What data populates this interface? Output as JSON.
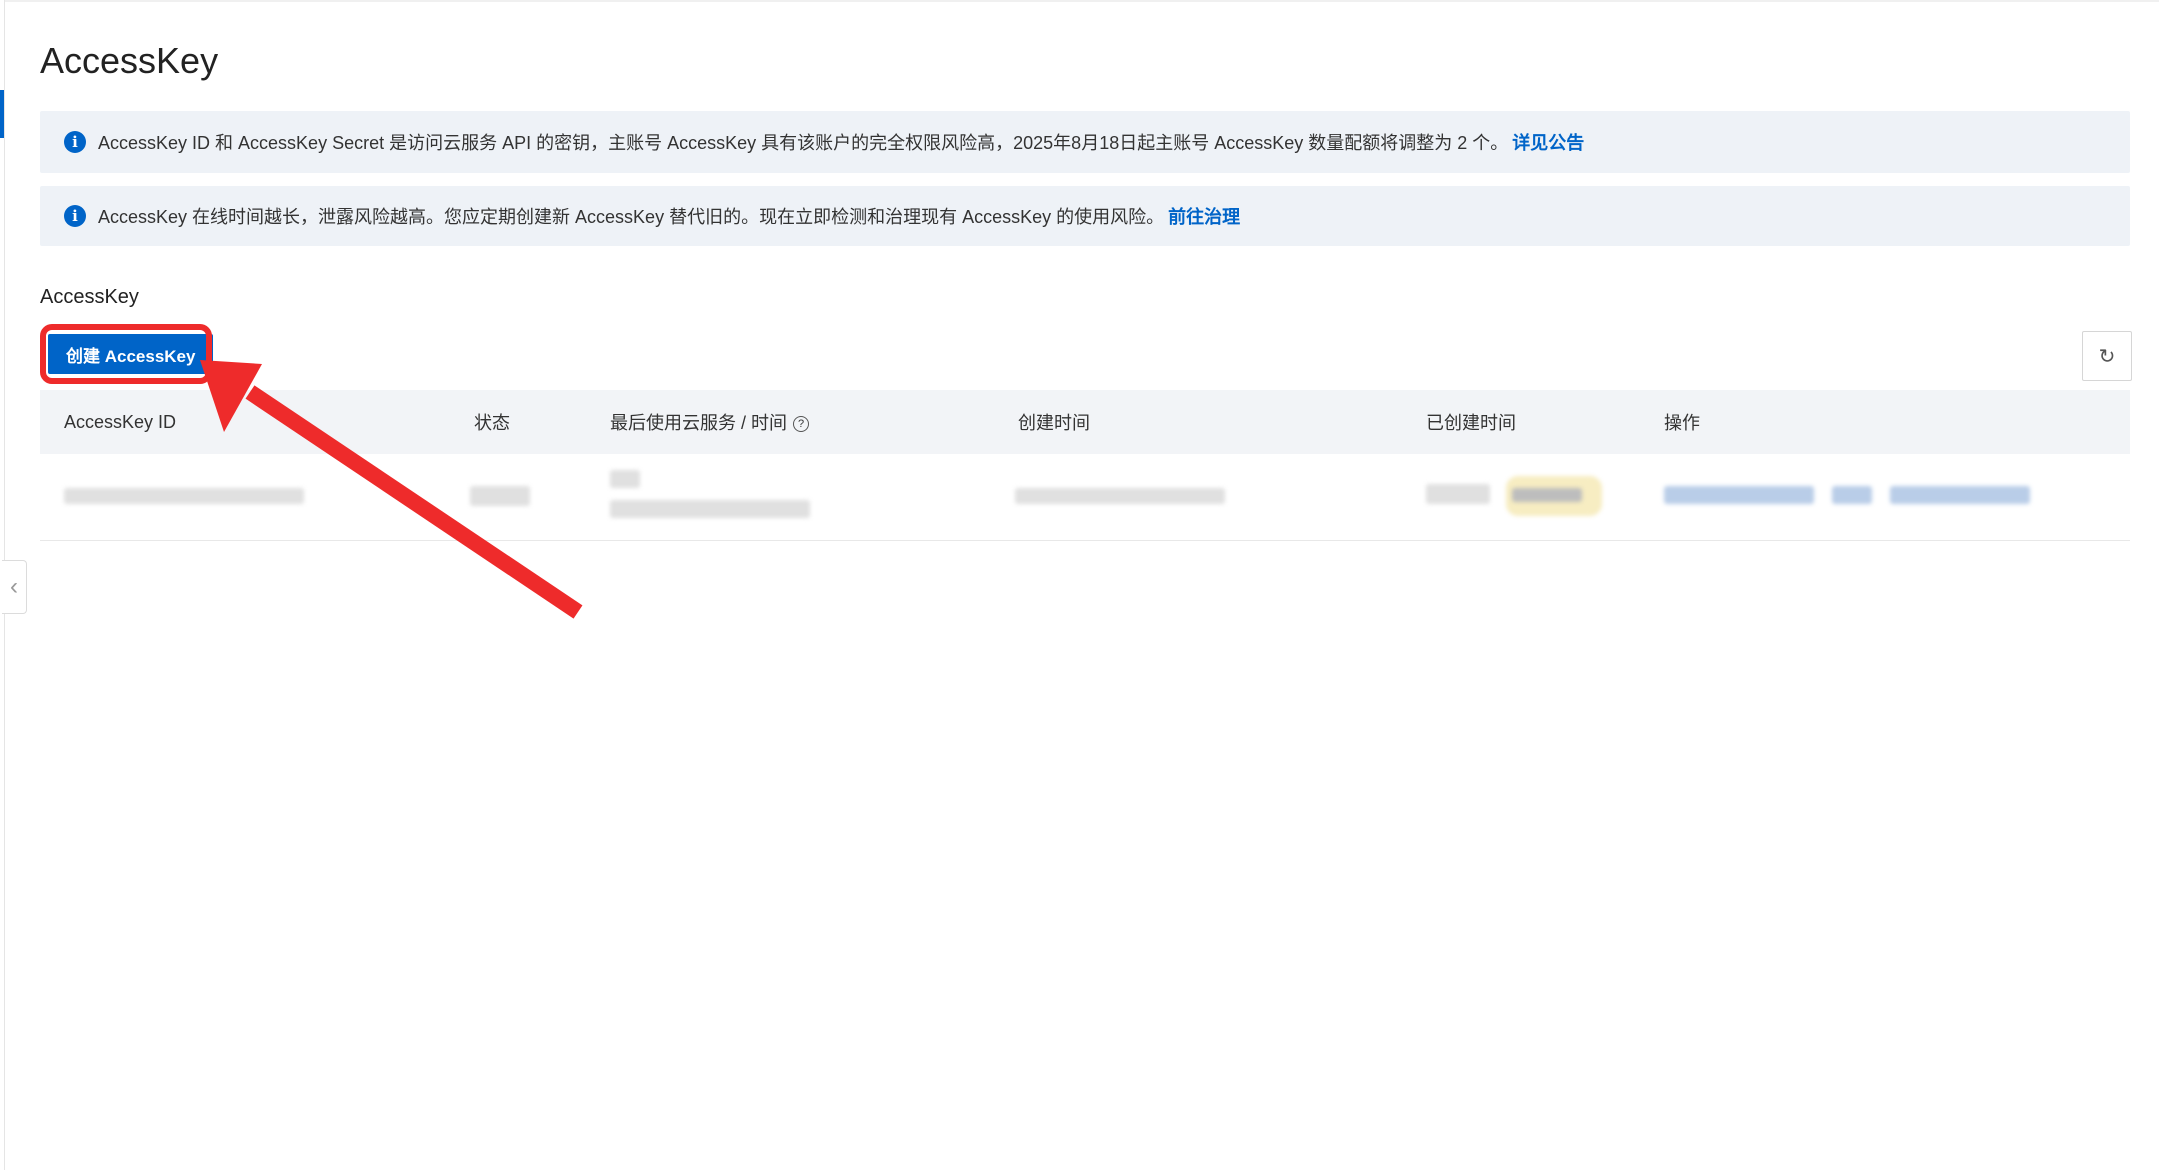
{
  "page": {
    "title": "AccessKey"
  },
  "notices": [
    {
      "text": "AccessKey ID 和 AccessKey Secret 是访问云服务 API 的密钥，主账号 AccessKey 具有该账户的完全权限风险高，2025年8月18日起主账号 AccessKey 数量配额将调整为 2 个。",
      "link": "详见公告"
    },
    {
      "text": "AccessKey 在线时间越长，泄露风险越高。您应定期创建新 AccessKey 替代旧的。现在立即检测和治理现有 AccessKey 的使用风险。",
      "link": "前往治理"
    }
  ],
  "section": {
    "label": "AccessKey",
    "create_button": "创建 AccessKey"
  },
  "table": {
    "columns": [
      "AccessKey ID",
      "状态",
      "最后使用云服务 / 时间",
      "创建时间",
      "已创建时间",
      "操作"
    ]
  },
  "icons": {
    "info": "info-circle-icon",
    "help": "question-circle-icon",
    "refresh": "refresh-icon",
    "collapse": "chevron-left-icon"
  },
  "colors": {
    "primary": "#0064c8",
    "annotation": "#ee2b2b",
    "notice_bg": "#eef2f7"
  }
}
